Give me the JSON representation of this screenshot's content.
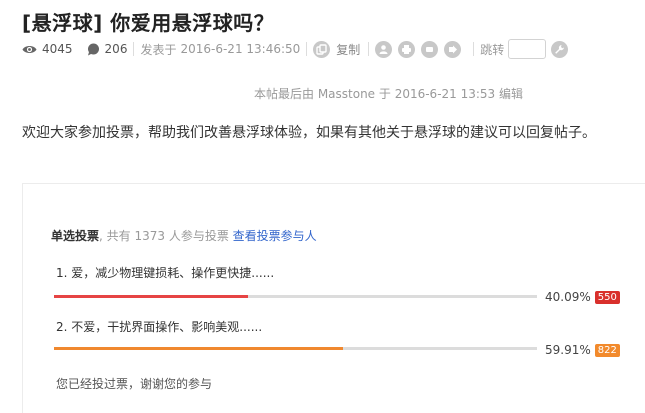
{
  "thread": {
    "title": "[悬浮球] 你爱用悬浮球吗？"
  },
  "meta": {
    "views": "4045",
    "replies": "206",
    "posted_label": "发表于",
    "posted_date": "2016-6-21 13:46:50",
    "copy_label": "复制",
    "jump_label": "跳转",
    "jump_value": ""
  },
  "edit_note": "本帖最后由 Masstone 于 2016-6-21 13:53 编辑",
  "post_body": "欢迎大家参加投票，帮助我们改善悬浮球体验，如果有其他关于悬浮球的建议可以回复帖子。",
  "poll": {
    "type_label": "单选投票",
    "summary": ", 共有 1373 人参与投票",
    "voters_link": "查看投票参与人",
    "options": [
      {
        "label": "1.  爱，减少物理键损耗、操作更快捷......",
        "percent_text": "40.09%",
        "fraction": 0.4009,
        "votes": "550",
        "bar_color": "#e64444",
        "badge_color": "#d9302c"
      },
      {
        "label": "2.  不爱，干扰界面操作、影响美观......",
        "percent_text": "59.91%",
        "fraction": 0.5991,
        "votes": "822",
        "bar_color": "#f0882e",
        "badge_color": "#f28a2c"
      }
    ],
    "voted_message": "您已经投过票，谢谢您的参与"
  },
  "icons": {
    "views": "eye-icon",
    "replies": "comment-icon",
    "copy": "copy-icon",
    "actions": [
      "user-icon",
      "print-icon",
      "previous-thread-icon",
      "next-thread-icon"
    ],
    "jump": "wrench-icon"
  },
  "colors": {
    "link": "#3366cc",
    "icon_gray": "#c8c8c8"
  }
}
